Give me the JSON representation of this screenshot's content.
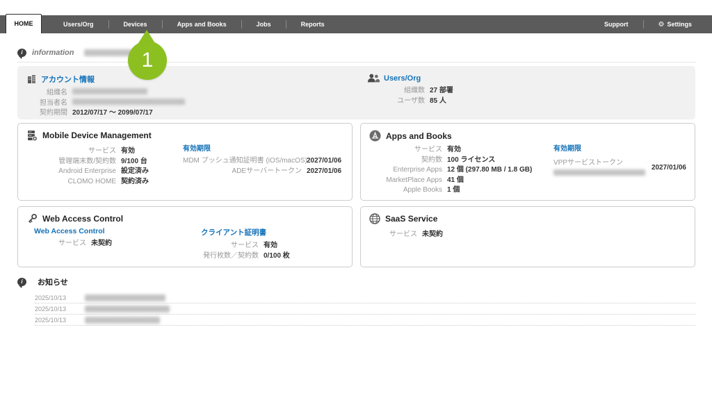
{
  "nav": {
    "tabs": [
      {
        "label": "HOME"
      },
      {
        "label": "Users/Org"
      },
      {
        "label": "Devices"
      },
      {
        "label": "Apps and Books"
      },
      {
        "label": "Jobs"
      },
      {
        "label": "Reports"
      }
    ],
    "support_label": "Support",
    "settings_label": "Settings"
  },
  "callout": {
    "number": "1"
  },
  "information": {
    "label": "information"
  },
  "colors": {
    "accent_green": "#8cc021",
    "link_blue": "#1472b8",
    "nav_gray": "#5b5b5b"
  },
  "account": {
    "title": "アカウント情報",
    "rows": [
      {
        "label": "組織名",
        "value": ""
      },
      {
        "label": "担当者名",
        "value": ""
      },
      {
        "label": "契約期間",
        "value": "2012/07/17 ～ 2099/07/17"
      }
    ]
  },
  "users_org": {
    "title": "Users/Org",
    "rows": [
      {
        "label": "組織数",
        "value": "27 部署"
      },
      {
        "label": "ユーザ数",
        "value": "85 人"
      }
    ]
  },
  "mdm": {
    "title": "Mobile Device Management",
    "rows": [
      {
        "label": "サービス",
        "value": "有効"
      },
      {
        "label": "管理端末数/契約数",
        "value": "9/100 台"
      },
      {
        "label": "Android Enterprise",
        "value": "設定済み"
      },
      {
        "label": "CLOMO HOME",
        "value": "契約済み"
      }
    ],
    "expiry": {
      "title": "有効期限",
      "rows": [
        {
          "label": "MDM プッシュ通知証明書 (iOS/macOS)",
          "value": "2027/01/06"
        },
        {
          "label": "ADEサーバートークン",
          "value": "2027/01/06"
        }
      ]
    }
  },
  "apps_books": {
    "title": "Apps and Books",
    "rows": [
      {
        "label": "サービス",
        "value": "有効"
      },
      {
        "label": "契約数",
        "value": "100 ライセンス"
      },
      {
        "label": "Enterprise Apps",
        "value": "12 個 (297.80 MB / 1.8 GB)"
      },
      {
        "label": "MarketPlace Apps",
        "value": "41 個"
      },
      {
        "label": "Apple Books",
        "value": "1 個"
      }
    ],
    "expiry": {
      "title": "有効期限",
      "token_label": "VPPサービストークン",
      "token_expiry": "2027/01/06"
    }
  },
  "web_access": {
    "title": "Web Access Control",
    "left": {
      "title": "Web Access Control",
      "rows": [
        {
          "label": "サービス",
          "value": "未契約"
        }
      ]
    },
    "right": {
      "title": "クライアント証明書",
      "rows": [
        {
          "label": "サービス",
          "value": "有効"
        },
        {
          "label": "発行枚数／契約数",
          "value": "0/100 枚"
        }
      ]
    }
  },
  "saas": {
    "title": "SaaS Service",
    "rows": [
      {
        "label": "サービス",
        "value": "未契約"
      }
    ]
  },
  "news": {
    "title": "お知らせ",
    "items": [
      {
        "date": "2025/10/13"
      },
      {
        "date": "2025/10/13"
      },
      {
        "date": "2025/10/13"
      }
    ]
  }
}
